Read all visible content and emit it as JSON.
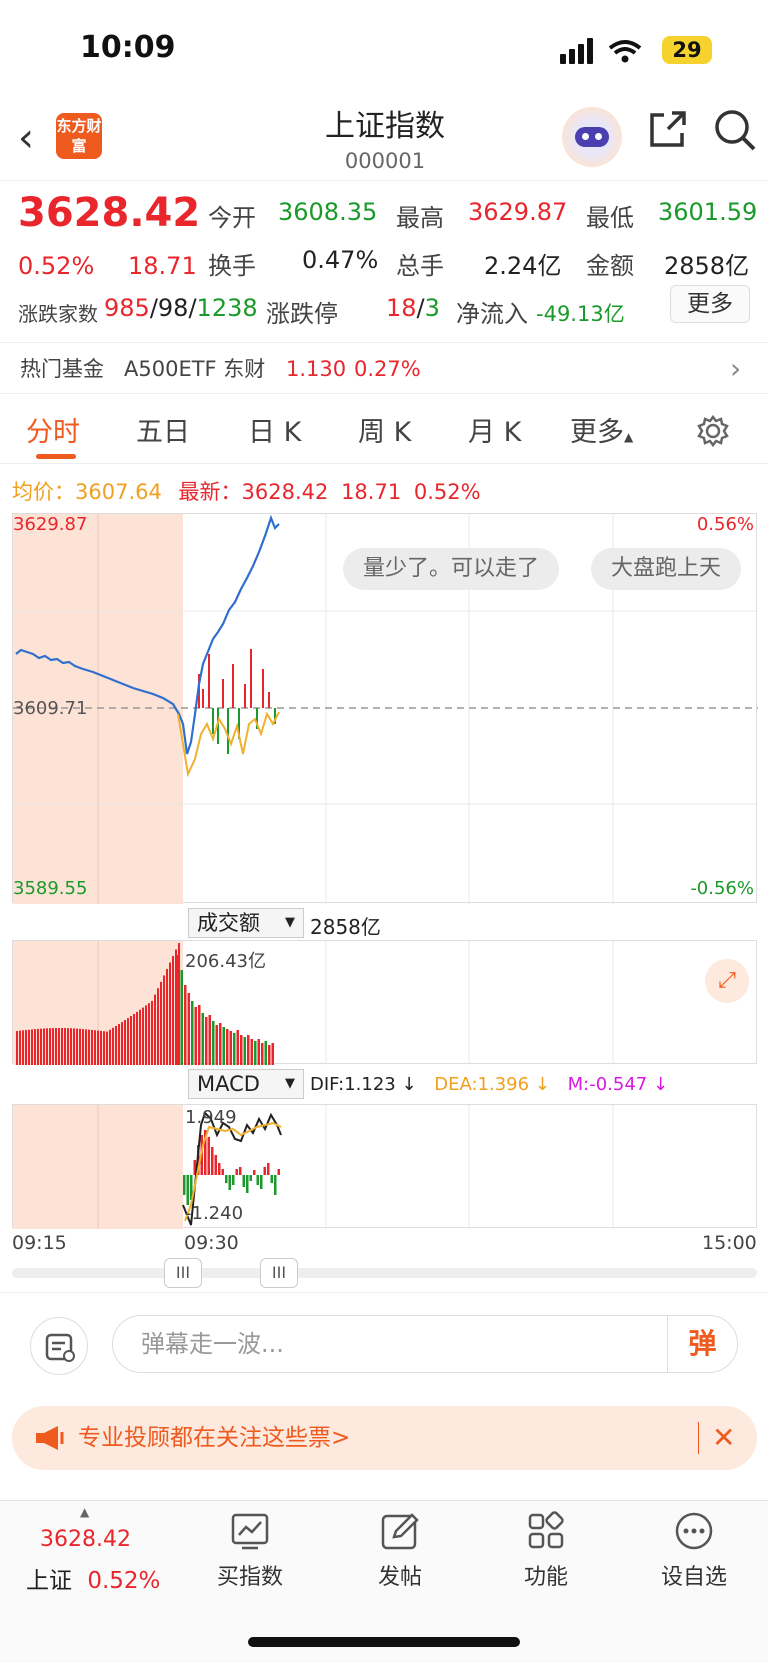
{
  "status": {
    "time": "10:09",
    "battery": "29"
  },
  "header": {
    "logo": "东方财富",
    "title": "上证指数",
    "code": "000001"
  },
  "quote": {
    "price": "3628.42",
    "pct": "0.52%",
    "change": "18.71",
    "open_label": "今开",
    "open": "3608.35",
    "high_label": "最高",
    "high": "3629.87",
    "low_label": "最低",
    "low": "3601.59",
    "turnover_rate_label": "换手",
    "turnover_rate": "0.47%",
    "volume_label": "总手",
    "volume": "2.24亿",
    "amount_label": "金额",
    "amount": "2858亿",
    "breadth_label": "涨跌家数",
    "up": "985",
    "flat": "98",
    "down": "1238",
    "limit_label": "涨跌停",
    "limit_up": "18",
    "limit_down": "3",
    "netflow_label": "净流入",
    "netflow": "-49.13亿",
    "more_button": "更多"
  },
  "fund": {
    "label": "热门基金",
    "name": "A500ETF 东财",
    "price": "1.130",
    "pct": "0.27%"
  },
  "tabs": [
    "分时",
    "五日",
    "日 K",
    "周 K",
    "月 K",
    "更多"
  ],
  "chart_info": {
    "avg_label": "均价：",
    "avg": "3607.64",
    "last_label": "最新：",
    "last": "3628.42",
    "change": "18.71",
    "pct": "0.52%"
  },
  "intraday": {
    "top_price": "3629.87",
    "mid_price": "3609.71",
    "bottom_price": "3589.55",
    "top_pct": "0.56%",
    "bottom_pct": "-0.56%",
    "bubble1": "量少了。可以走了",
    "bubble2": "大盘跑上天"
  },
  "volume_panel": {
    "selector": "成交额",
    "total": "2858亿",
    "max_label": "206.43亿"
  },
  "macd_panel": {
    "selector": "MACD",
    "dif": "DIF:1.123 ↓",
    "dea": "DEA:1.396 ↓",
    "m": "M:-0.547 ↓",
    "top": "1.949",
    "bottom": "-1.240"
  },
  "time_axis": {
    "t1": "09:15",
    "t2": "09:30",
    "t3": "15:00"
  },
  "danmu": {
    "placeholder": "弹幕走一波...",
    "button": "弹"
  },
  "notice": {
    "text": "专业投顾都在关注这些票>"
  },
  "bottom": {
    "price": "3628.42",
    "name": "上证",
    "pct": "0.52%",
    "items": [
      "买指数",
      "发帖",
      "功能",
      "设自选"
    ]
  }
}
